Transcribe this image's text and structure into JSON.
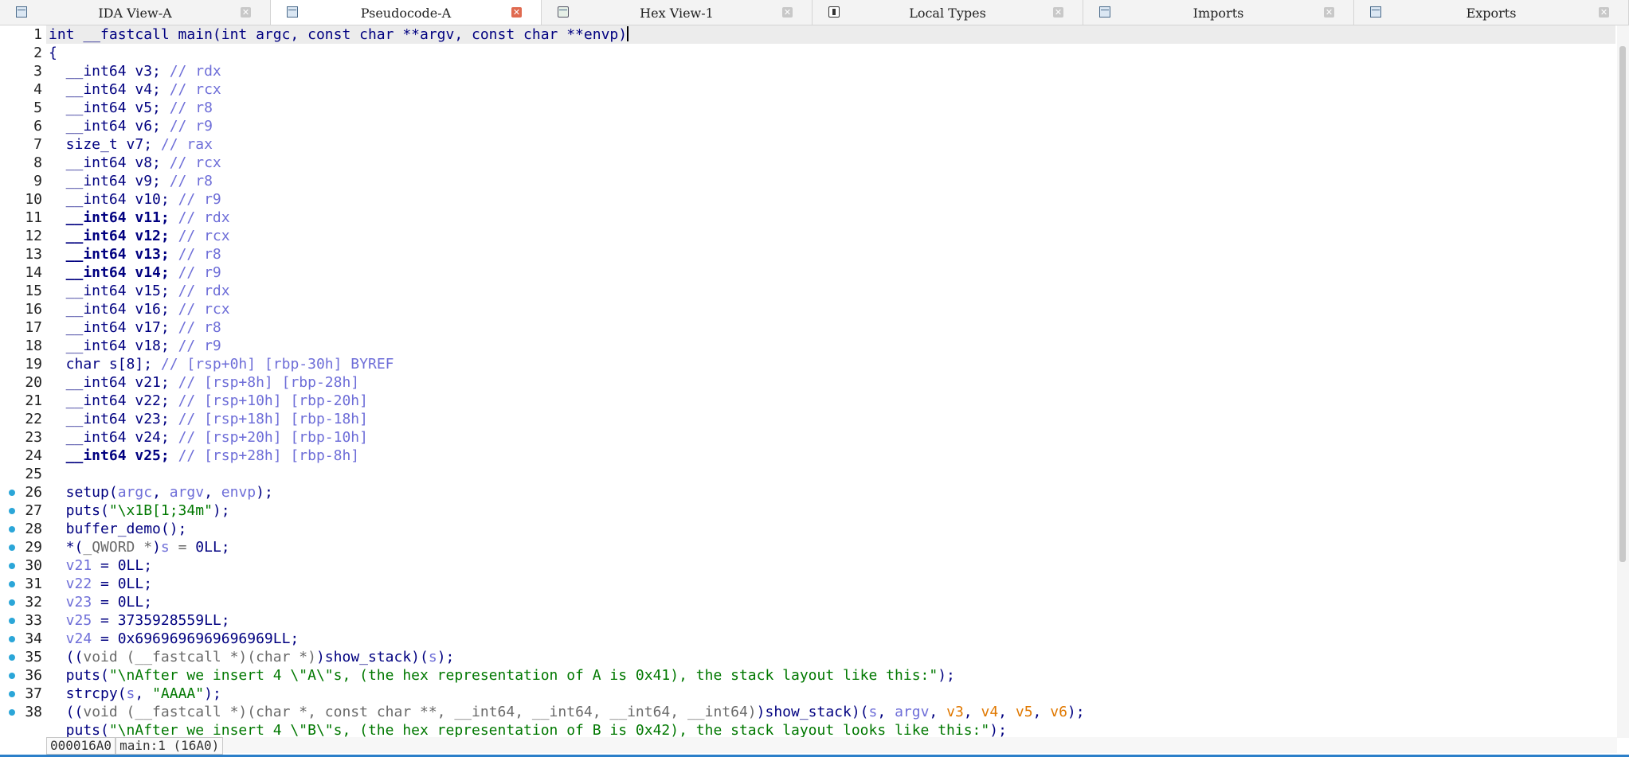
{
  "tabs": [
    {
      "label": "IDA View-A",
      "icon": "ida-view-icon",
      "active": false,
      "close": "✕"
    },
    {
      "label": "Pseudocode-A",
      "icon": "pseudocode-icon",
      "active": true,
      "close": "✕"
    },
    {
      "label": "Hex View-1",
      "icon": "hex-view-icon",
      "active": false,
      "close": "✕"
    },
    {
      "label": "Local Types",
      "icon": "local-types-icon",
      "active": false,
      "close": "✕"
    },
    {
      "label": "Imports",
      "icon": "imports-icon",
      "active": false,
      "close": "✕"
    },
    {
      "label": "Exports",
      "icon": "exports-icon",
      "active": false,
      "close": "✕"
    }
  ],
  "code_lines": [
    {
      "n": "1",
      "bp": false,
      "seg": [
        [
          "",
          "int __fastcall main(int argc, const char **argv, const char **envp)"
        ]
      ],
      "caret": true,
      "current": true
    },
    {
      "n": "2",
      "bp": false,
      "seg": [
        [
          "",
          "{"
        ]
      ]
    },
    {
      "n": "3",
      "bp": false,
      "seg": [
        [
          "",
          "  __int64 v3; "
        ],
        [
          "cm",
          "// rdx"
        ]
      ]
    },
    {
      "n": "4",
      "bp": false,
      "seg": [
        [
          "",
          "  __int64 v4; "
        ],
        [
          "cm",
          "// rcx"
        ]
      ]
    },
    {
      "n": "5",
      "bp": false,
      "seg": [
        [
          "",
          "  __int64 v5; "
        ],
        [
          "cm",
          "// r8"
        ]
      ]
    },
    {
      "n": "6",
      "bp": false,
      "seg": [
        [
          "",
          "  __int64 v6; "
        ],
        [
          "cm",
          "// r9"
        ]
      ]
    },
    {
      "n": "7",
      "bp": false,
      "seg": [
        [
          "",
          "  size_t v7; "
        ],
        [
          "cm",
          "// rax"
        ]
      ]
    },
    {
      "n": "8",
      "bp": false,
      "seg": [
        [
          "",
          "  __int64 v8; "
        ],
        [
          "cm",
          "// rcx"
        ]
      ]
    },
    {
      "n": "9",
      "bp": false,
      "seg": [
        [
          "",
          "  __int64 v9; "
        ],
        [
          "cm",
          "// r8"
        ]
      ]
    },
    {
      "n": "10",
      "bp": false,
      "seg": [
        [
          "",
          "  __int64 v10; "
        ],
        [
          "cm",
          "// r9"
        ]
      ]
    },
    {
      "n": "11",
      "bp": false,
      "seg": [
        [
          "bold",
          "  __int64 v11; "
        ],
        [
          "cm",
          "// rdx"
        ]
      ]
    },
    {
      "n": "12",
      "bp": false,
      "seg": [
        [
          "bold",
          "  __int64 v12; "
        ],
        [
          "cm",
          "// rcx"
        ]
      ]
    },
    {
      "n": "13",
      "bp": false,
      "seg": [
        [
          "bold",
          "  __int64 v13; "
        ],
        [
          "cm",
          "// r8"
        ]
      ]
    },
    {
      "n": "14",
      "bp": false,
      "seg": [
        [
          "bold",
          "  __int64 v14; "
        ],
        [
          "cm",
          "// r9"
        ]
      ]
    },
    {
      "n": "15",
      "bp": false,
      "seg": [
        [
          "",
          "  __int64 v15; "
        ],
        [
          "cm",
          "// rdx"
        ]
      ]
    },
    {
      "n": "16",
      "bp": false,
      "seg": [
        [
          "",
          "  __int64 v16; "
        ],
        [
          "cm",
          "// rcx"
        ]
      ]
    },
    {
      "n": "17",
      "bp": false,
      "seg": [
        [
          "",
          "  __int64 v17; "
        ],
        [
          "cm",
          "// r8"
        ]
      ]
    },
    {
      "n": "18",
      "bp": false,
      "seg": [
        [
          "",
          "  __int64 v18; "
        ],
        [
          "cm",
          "// r9"
        ]
      ]
    },
    {
      "n": "19",
      "bp": false,
      "seg": [
        [
          "",
          "  char s[8]; "
        ],
        [
          "cm",
          "// [rsp+0h] [rbp-30h] BYREF"
        ]
      ]
    },
    {
      "n": "20",
      "bp": false,
      "seg": [
        [
          "",
          "  __int64 v21; "
        ],
        [
          "cm",
          "// [rsp+8h] [rbp-28h]"
        ]
      ]
    },
    {
      "n": "21",
      "bp": false,
      "seg": [
        [
          "",
          "  __int64 v22; "
        ],
        [
          "cm",
          "// [rsp+10h] [rbp-20h]"
        ]
      ]
    },
    {
      "n": "22",
      "bp": false,
      "seg": [
        [
          "",
          "  __int64 v23; "
        ],
        [
          "cm",
          "// [rsp+18h] [rbp-18h]"
        ]
      ]
    },
    {
      "n": "23",
      "bp": false,
      "seg": [
        [
          "",
          "  __int64 v24; "
        ],
        [
          "cm",
          "// [rsp+20h] [rbp-10h]"
        ]
      ]
    },
    {
      "n": "24",
      "bp": false,
      "seg": [
        [
          "bold",
          "  __int64 v25; "
        ],
        [
          "cm",
          "// [rsp+28h] [rbp-8h]"
        ]
      ]
    },
    {
      "n": "25",
      "bp": false,
      "seg": [
        [
          "",
          ""
        ]
      ]
    },
    {
      "n": "26",
      "bp": true,
      "seg": [
        [
          "",
          "  setup("
        ],
        [
          "vr",
          "argc"
        ],
        [
          "",
          ", "
        ],
        [
          "vr",
          "argv"
        ],
        [
          "",
          ", "
        ],
        [
          "vr",
          "envp"
        ],
        [
          "",
          ");"
        ]
      ]
    },
    {
      "n": "27",
      "bp": true,
      "seg": [
        [
          "",
          "  puts("
        ],
        [
          "st",
          "\"\\x1B[1;34m\""
        ],
        [
          "",
          ");"
        ]
      ]
    },
    {
      "n": "28",
      "bp": true,
      "seg": [
        [
          "",
          "  buffer_demo();"
        ]
      ]
    },
    {
      "n": "29",
      "bp": true,
      "seg": [
        [
          "",
          "  *("
        ],
        [
          "dk",
          "_QWORD *"
        ],
        [
          "",
          ")"
        ],
        [
          "vr",
          "s"
        ],
        [
          "dk",
          " = "
        ],
        [
          "",
          "0LL;"
        ]
      ]
    },
    {
      "n": "30",
      "bp": true,
      "seg": [
        [
          "vr",
          "  v21"
        ],
        [
          "",
          " = 0LL;"
        ]
      ]
    },
    {
      "n": "31",
      "bp": true,
      "seg": [
        [
          "vr",
          "  v22"
        ],
        [
          "",
          " = 0LL;"
        ]
      ]
    },
    {
      "n": "32",
      "bp": true,
      "seg": [
        [
          "vr",
          "  v23"
        ],
        [
          "",
          " = 0LL;"
        ]
      ]
    },
    {
      "n": "33",
      "bp": true,
      "seg": [
        [
          "vr",
          "  v25"
        ],
        [
          "",
          " = 3735928559LL;"
        ]
      ]
    },
    {
      "n": "34",
      "bp": true,
      "seg": [
        [
          "vr",
          "  v24"
        ],
        [
          "",
          " = 0x6969696969696969LL;"
        ]
      ]
    },
    {
      "n": "35",
      "bp": true,
      "seg": [
        [
          "",
          "  (("
        ],
        [
          "dk",
          "void (__fastcall *)(char *)"
        ],
        [
          "",
          ")show_stack)("
        ],
        [
          "vr",
          "s"
        ],
        [
          "",
          ");"
        ]
      ]
    },
    {
      "n": "36",
      "bp": true,
      "seg": [
        [
          "",
          "  puts("
        ],
        [
          "st",
          "\"\\nAfter we insert 4 \\\"A\\\"s, (the hex representation of A is 0x41), the stack layout like this:\""
        ],
        [
          "",
          ");"
        ]
      ]
    },
    {
      "n": "37",
      "bp": true,
      "seg": [
        [
          "",
          "  strcpy("
        ],
        [
          "vr",
          "s"
        ],
        [
          "",
          ", "
        ],
        [
          "st",
          "\"AAAA\""
        ],
        [
          "",
          ");"
        ]
      ]
    },
    {
      "n": "38",
      "bp": true,
      "seg": [
        [
          "",
          "  (("
        ],
        [
          "dk",
          "void (__fastcall *)(char *, const char **, __int64, __int64, __int64, __int64)"
        ],
        [
          "",
          ")show_stack)("
        ],
        [
          "vr",
          "s"
        ],
        [
          "",
          ", "
        ],
        [
          "vr",
          "argv"
        ],
        [
          "",
          ", "
        ],
        [
          "or",
          "v3"
        ],
        [
          "",
          ", "
        ],
        [
          "or",
          "v4"
        ],
        [
          "",
          ", "
        ],
        [
          "or",
          "v5"
        ],
        [
          "",
          ", "
        ],
        [
          "or",
          "v6"
        ],
        [
          "",
          ");"
        ]
      ]
    },
    {
      "n": "",
      "bp": false,
      "seg": [
        [
          "",
          "  puts("
        ],
        [
          "st",
          "\"\\nAfter we insert 4 \\\"B\\\"s, (the hex representation of B is 0x42), the stack layout looks like this:\""
        ],
        [
          "",
          ");"
        ]
      ]
    }
  ],
  "status": {
    "address": "000016A0",
    "location": "main:1 (16A0)"
  },
  "colors": {
    "keyword": "#000080",
    "comment": "#6e6ed8",
    "string": "#007800",
    "breakpoint": "#2ba6d8"
  }
}
